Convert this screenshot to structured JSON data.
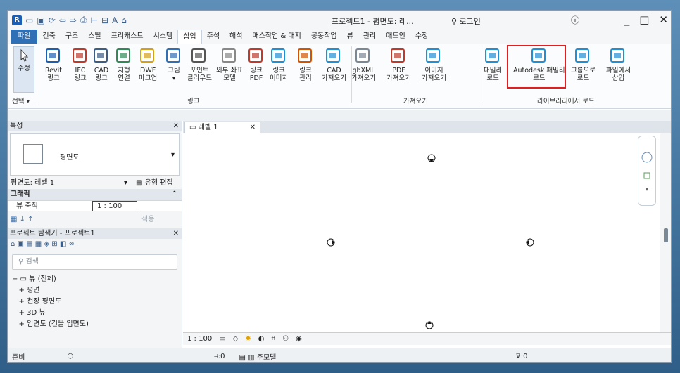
{
  "titlebar": {
    "app_icon": "R",
    "title": "프로젝트1 - 평면도: 레...",
    "search_icon": "binoculars-icon",
    "login": "로그인",
    "help": "?",
    "minimize": "_",
    "maximize": "□",
    "close": "✕"
  },
  "menu": [
    "파일",
    "건축",
    "구조",
    "스틸",
    "프리캐스트",
    "시스템",
    "삽입",
    "주석",
    "해석",
    "매스작업 & 대지",
    "공동작업",
    "뷰",
    "관리",
    "애드인",
    "수정"
  ],
  "menu_active": "삽입",
  "ribbon": {
    "modify": "수정",
    "select": "선택 ▾",
    "buttons": [
      {
        "l1": "Revit",
        "l2": "링크"
      },
      {
        "l1": "IFC",
        "l2": "링크"
      },
      {
        "l1": "CAD",
        "l2": "링크"
      },
      {
        "l1": "지형",
        "l2": "연결"
      },
      {
        "l1": "DWF",
        "l2": "마크업"
      },
      {
        "l1": "그림",
        "l2": "▾"
      },
      {
        "l1": "포인트",
        "l2": "클라우드"
      },
      {
        "l1": "외부 좌표",
        "l2": "모델"
      },
      {
        "l1": "링크",
        "l2": "PDF"
      },
      {
        "l1": "링크",
        "l2": "이미지"
      },
      {
        "l1": "링크",
        "l2": "관리"
      },
      {
        "l1": "CAD",
        "l2": "가져오기"
      },
      {
        "l1": "gbXML",
        "l2": "가져오기"
      },
      {
        "l1": "PDF",
        "l2": "가져오기"
      },
      {
        "l1": "이미지",
        "l2": "가져오기"
      },
      {
        "l1": "패밀리",
        "l2": "로드"
      },
      {
        "l1": "Autodesk 패밀리",
        "l2": "로드"
      },
      {
        "l1": "그룹으로",
        "l2": "로드"
      },
      {
        "l1": "파일에서",
        "l2": "삽입"
      }
    ],
    "groups": {
      "link": "링크",
      "import": "가져오기",
      "library": "라이브러리에서 로드"
    }
  },
  "properties": {
    "header": "특성",
    "type": "평면도",
    "view_label": "평면도: 레벨 1",
    "edit_type": "유형 편집",
    "graphics": "그래픽",
    "scale_label": "뷰 축척",
    "scale_value": "1 : 100",
    "apply": "적용"
  },
  "browser": {
    "header": "프로젝트 탐색기 - 프로젝트1",
    "search_placeholder": "검색",
    "items": [
      "뷰 (전체)",
      "평면",
      "천장 평면도",
      "3D 뷰",
      "입면도 (건물 입면도)"
    ]
  },
  "view_tab": "레벨 1",
  "view_scale": "1 : 100",
  "status": {
    "ready": "준비",
    "selection": ":0",
    "model": "주모델",
    "filter": ":0"
  }
}
